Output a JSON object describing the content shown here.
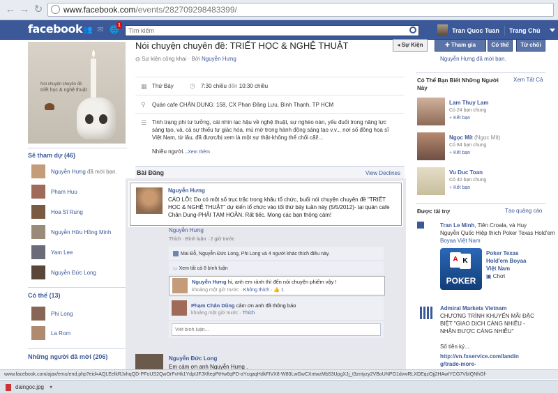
{
  "browser": {
    "url_main": "www.facebook.com",
    "url_path": "/events/282709298483399/",
    "status_url": "www.facebook.com/ajax/emu/end.php?eid=AQLEelkRJvhqQD-PFoUS2QwOrFvHk1YdpIJFJXftepPtHw6qPD-aYcqaqHdkFIVX8-W80LwGwCXntwzMb53UpgXJj_t3zntyzy2VBoUNPO1dvwRLXDEqzOjj2HAwIYCG7VbIQNhGf-",
    "download_file": "daingoc.jpg"
  },
  "header": {
    "logo": "facebook",
    "notif_count": "1",
    "search_placeholder": "Tìm kiếm",
    "user_name": "Tran Quoc Tuan",
    "home": "Trang Chủ"
  },
  "left": {
    "cover_line1": "Nói chuyện chuyên đề",
    "cover_line2": "triết học & nghệ thuật",
    "attending_title": "Sẽ tham dự (46)",
    "attending": [
      {
        "name": "Nguyễn Hưng",
        "extra": " đã mời bạn."
      },
      {
        "name": "Pham Huu",
        "extra": ""
      },
      {
        "name": "Hoa Sĩ Rung",
        "extra": ""
      },
      {
        "name": "Nguyễn Hữu Hồng Minh",
        "extra": ""
      },
      {
        "name": "Yam Lee",
        "extra": ""
      },
      {
        "name": "Nguyễn Đức Long",
        "extra": ""
      }
    ],
    "maybe_title": "Có thể (13)",
    "maybe": [
      {
        "name": "Phi Long"
      },
      {
        "name": "La Rom"
      }
    ],
    "invited_title": "Những người đã mời (206)"
  },
  "event": {
    "title": "Nói chuyện chuyên đề: TRIẾT HỌC & NGHỆ THUẬT",
    "public": "Sự kiện công khai",
    "by": "· Bởi",
    "host": "Nguyễn Hưng",
    "btn_events": "◂ Sự Kiện",
    "btn_join": "Tham gia",
    "btn_maybe": "Có thể",
    "btn_decline": "Từ chối",
    "guest_note": "Nguyễn Hưng đã mời bạn.",
    "day": "Thứ Bảy",
    "time_from": "7:30 chiều",
    "time_to_label": "đến",
    "time_to": "10:30 chiều",
    "location": "Quán cafe CHÂN DUNG: 158, CX Phan Đăng Lưu, Bình Thạnh, TP HCM",
    "desc1": "Tinh trạng phi tư tưởng, cái nhìn lạc hậu về nghệ thuật, sự nghèo nàn, yếu đuối trong năng lực",
    "desc2": "sáng tạo, và, cả sự thiếu tự giác hóa, mù mờ trong hành động sáng tạo v.v... nơi số đông họa sĩ",
    "desc3": "Việt Nam, từ lâu, đã được/bị xem là một sự thật-không thể chối cãi!...",
    "desc4": "Nhiều người...",
    "see_more": "Xem thêm"
  },
  "posts": {
    "title": "Bài Đăng",
    "view_declines": "View Declines",
    "author": "Nguyễn Hưng",
    "body": "CÁO LỖI: Do có một số trục trặc trong khâu tổ chức, buổi nói chuyện chuyên đề \"TRIẾT HỌC & NGHỆ THUẬT\" dự kiến tổ chức vào tối thứ bảy tuần này (5/5/2012)- tại quán cafe Chân Dung-PHẢI TẠM HOÃN. Rất tiếc. Mong các bạn thông cảm!",
    "meta_name": "Nguyễn Hưng",
    "actions": "Thích · Bình luận · 2 giờ trước",
    "likes": "Mai Đỗ, Nguyễn Đức Long, Phi Long và 4 người khác thích điều này.",
    "view_all": "Xem tất cả 8 bình luận",
    "comments": [
      {
        "name": "Nguyễn Hưng",
        "text": " hi, anh em rảnh thì đến nói chuyện phiếm vậy !",
        "meta": "khoảng một giờ trước ·",
        "action": "Không thích",
        "likes": "· 👍 1"
      },
      {
        "name": "Phạm Chân Dũng",
        "text": " cảm ơn anh đã thông báo",
        "meta": "khoảng một giờ trước ·",
        "action": "Thích",
        "likes": ""
      }
    ],
    "comment_placeholder": "Viết bình luận...",
    "next_author": "Nguyễn Đức Long",
    "next_body": "Em cảm ơn anh Nguyễn Hưng ."
  },
  "right": {
    "pymk_title": "Có Thể Bạn Biết Những Người Này",
    "see_all": "Xem Tất Cả",
    "pymk": [
      {
        "name": "Lam Thuy Lam",
        "alias": "",
        "friends": "Có 24 bạn chung",
        "action": "Kết bạn"
      },
      {
        "name": "Ngọc Mít",
        "alias": " (Ngọc Mít)",
        "friends": "Có 84 bạn chung",
        "action": "Kết bạn"
      },
      {
        "name": "Vu Duc Toan",
        "alias": "",
        "friends": "Có 40 bạn chung",
        "action": "Kết bạn"
      }
    ],
    "sponsored_title": "Được tài trợ",
    "create_ad": "Tạo quảng cáo",
    "ad1_line1a": "Tran Le Minh",
    "ad1_line1b": ", Tiên Croala, và Huy",
    "ad1_line2": "Nguyễn Quốc Hiệp thích Poker Texas Hold'em",
    "ad1_line3": "Boyaa Việt Nam",
    "ad2_title1": "Poker Texas",
    "ad2_title2": "Hold'em Boyaa",
    "ad2_title3": "Việt Nam",
    "ad2_cta": "Chơi",
    "ad2_logo": "POKER",
    "ad3_title": "Admiral Markets Vietnam",
    "ad3_l1": "CHƯƠNG TRÌNH KHUYẾN MÃI ĐẶC",
    "ad3_l2": "BIỆT \"GIAO DỊCH CÀNG NHIỀU -",
    "ad3_l3": "NHẬN ĐƯỢC CÀNG NHIỀU\"",
    "ad3_l4": "Số tiền ký...",
    "ad3_l5": "http://vn.fxservice.com/landin",
    "ad3_l6": "g/trade-more-"
  }
}
